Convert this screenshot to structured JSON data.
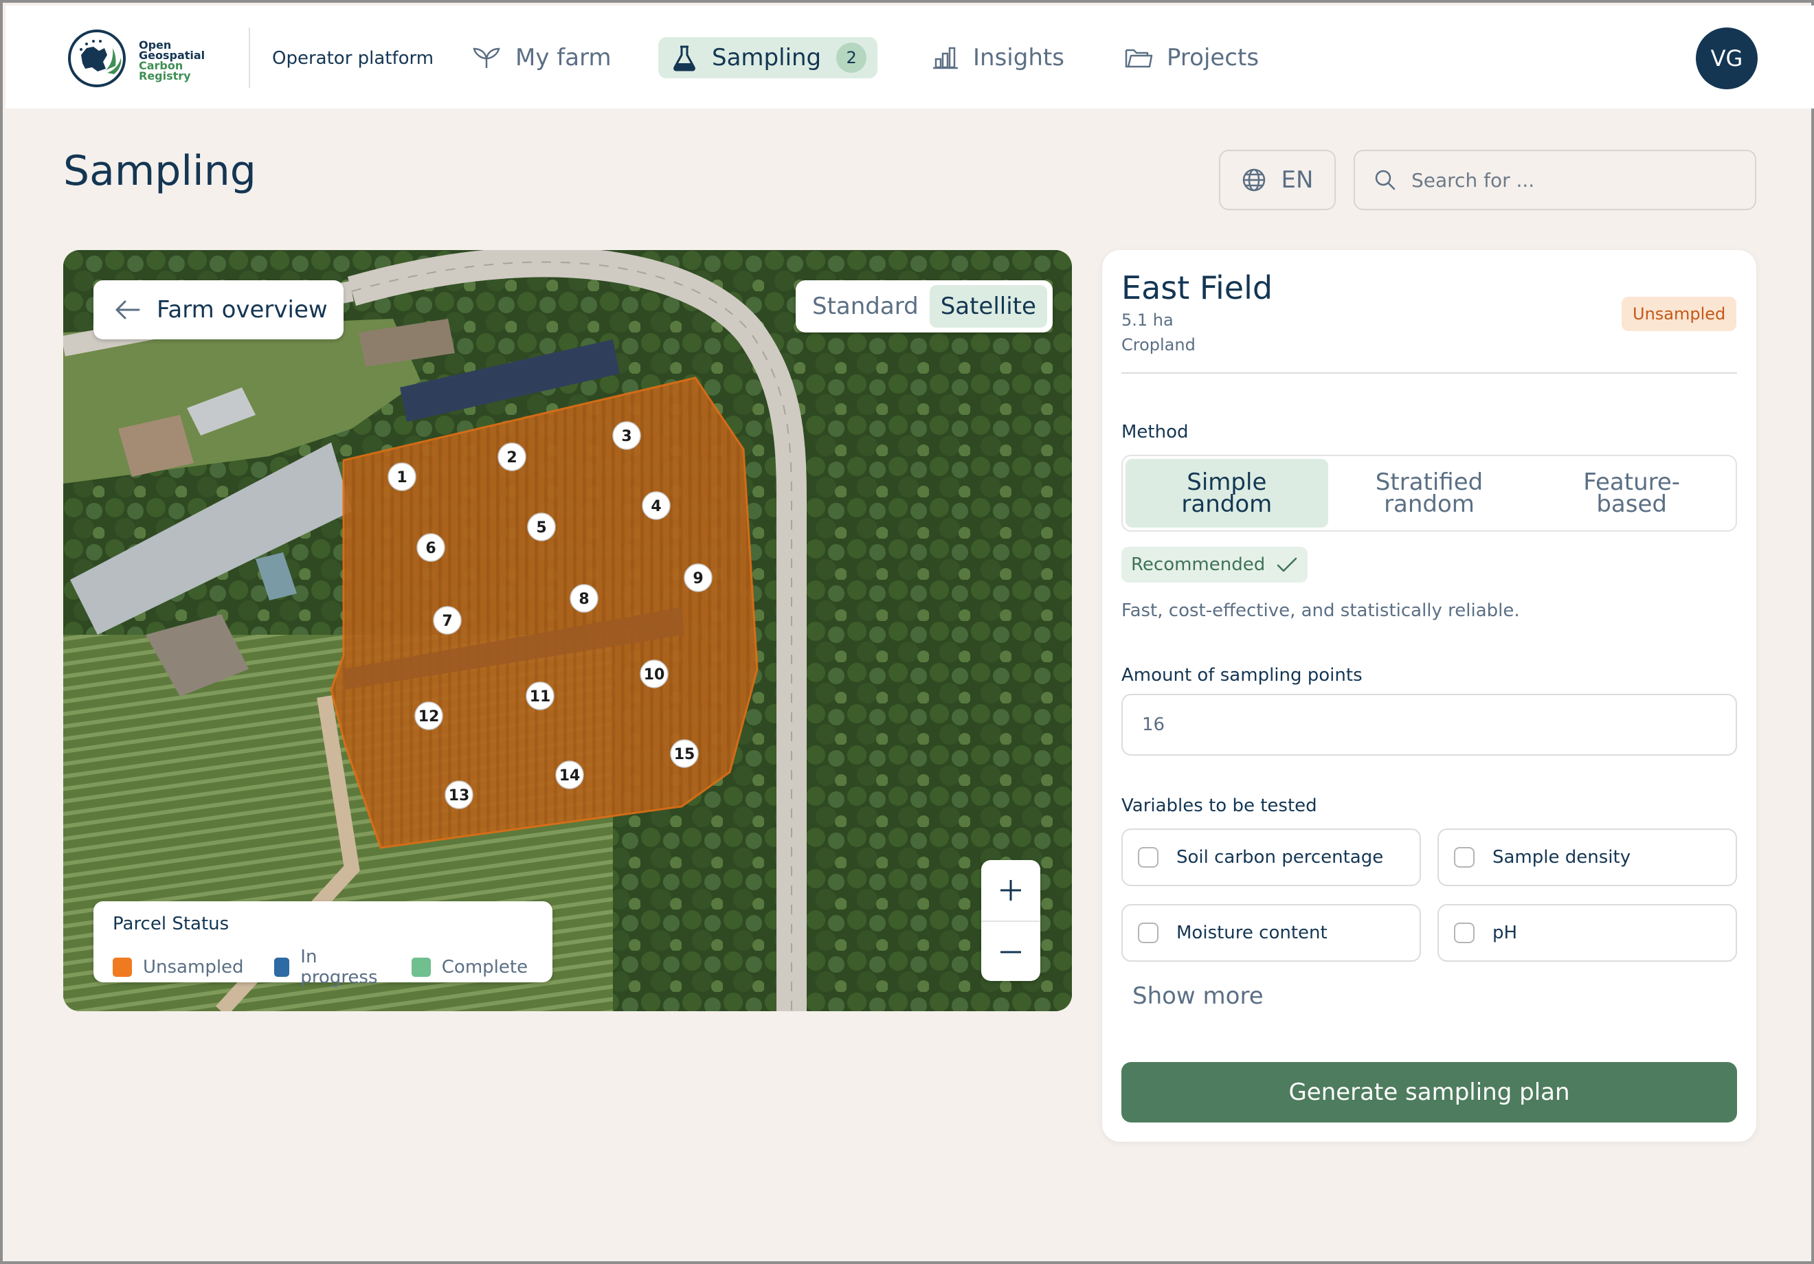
{
  "header": {
    "logo_text": [
      "Open",
      "Geospatial",
      "Carbon Registry"
    ],
    "platform_label": "Operator platform",
    "nav": [
      {
        "label": "My farm",
        "icon": "sprout-icon",
        "active": false
      },
      {
        "label": "Sampling",
        "icon": "flask-icon",
        "active": true,
        "badge": "2"
      },
      {
        "label": "Insights",
        "icon": "bar-chart-icon",
        "active": false
      },
      {
        "label": "Projects",
        "icon": "folder-icon",
        "active": false
      }
    ],
    "avatar_initials": "VG"
  },
  "page": {
    "title": "Sampling",
    "language": "EN",
    "search_placeholder": "Search for ..."
  },
  "map": {
    "back_label": "Farm overview",
    "view_toggle": {
      "options": [
        "Standard",
        "Satellite"
      ],
      "selected": "Satellite"
    },
    "zoom_in_icon": "plus-icon",
    "zoom_out_icon": "minus-icon",
    "sampling_points": [
      "1",
      "2",
      "3",
      "4",
      "5",
      "6",
      "7",
      "8",
      "9",
      "10",
      "11",
      "12",
      "13",
      "14",
      "15"
    ],
    "legend": {
      "title": "Parcel Status",
      "items": [
        {
          "label": "Unsampled",
          "color": "#f07a20"
        },
        {
          "label": "In progress",
          "color": "#2e6aa3"
        },
        {
          "label": "Complete",
          "color": "#6fbf8f"
        }
      ]
    }
  },
  "panel": {
    "field_name": "East Field",
    "area": "5.1 ha",
    "land_use": "Cropland",
    "status": "Unsampled",
    "method_label": "Method",
    "methods": [
      "Simple random",
      "Stratified random",
      "Feature-based"
    ],
    "selected_method": "Simple random",
    "recommended_label": "Recommended",
    "method_description": "Fast, cost-effective, and statistically reliable.",
    "points_label": "Amount of sampling points",
    "points_value": "16",
    "variables_label": "Variables to be tested",
    "variables": [
      {
        "label": "Soil carbon percentage",
        "checked": false
      },
      {
        "label": "Sample density",
        "checked": false
      },
      {
        "label": "Moisture content",
        "checked": false
      },
      {
        "label": "pH",
        "checked": false
      }
    ],
    "show_more": "Show more",
    "generate_button": "Generate sampling plan"
  },
  "colors": {
    "brand_navy": "#143653",
    "accent_green": "#4e7c5e",
    "active_nav_bg": "#dcece2",
    "unsampled_orange": "#f07a20"
  }
}
